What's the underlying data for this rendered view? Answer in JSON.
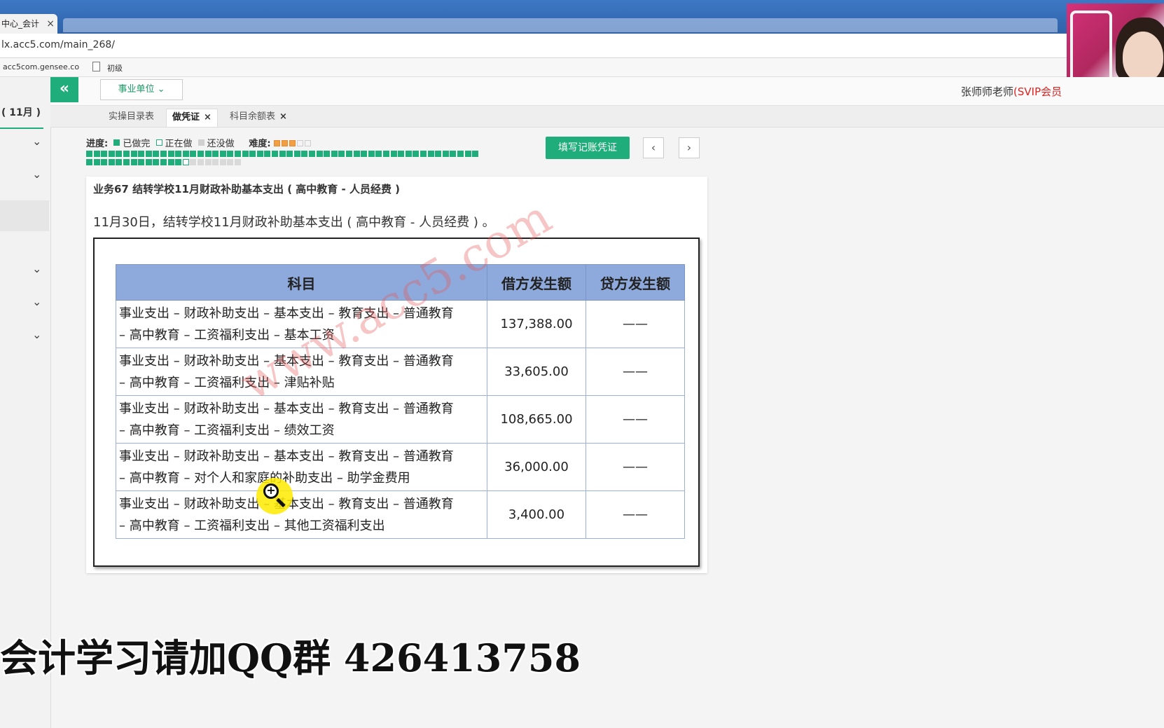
{
  "browser": {
    "tab_title": "中心_会计",
    "tab_close": "×",
    "url": "lx.acc5.com/main_268/",
    "bookmarks": [
      "acc5com.gensee.co",
      "初级"
    ]
  },
  "sidebar": {
    "title": "( 11月 )",
    "chevron": "⌄"
  },
  "header": {
    "collapse_label": "«",
    "unit_select": "事业单位 ⌄",
    "teacher_name": "张师师老师",
    "teacher_badge": "(SVIP会员"
  },
  "page_tabs": [
    {
      "label": "实操目录表",
      "closable": false
    },
    {
      "label": "做凭证",
      "closable": true
    },
    {
      "label": "科目余额表",
      "closable": true
    }
  ],
  "progress": {
    "label": "进度:",
    "legend_done": "已做完",
    "legend_doing": "正在做",
    "legend_todo": "还没做",
    "difficulty_label": "难度:",
    "difficulty_stars": 3,
    "difficulty_max": 5,
    "done_count": 66,
    "current_index": 23,
    "todo_count": 10,
    "colors": {
      "done": "#1fae7b",
      "doing": "#ffffff",
      "todo": "#d9d9d9"
    }
  },
  "actions": {
    "fill_voucher": "填写记账凭证",
    "prev": "‹",
    "next": "›"
  },
  "business": {
    "title": "业务67 结转学校11月财政补助基本支出 ( 高中教育 - 人员经费 )",
    "description": "11月30日，结转学校11月财政补助基本支出 ( 高中教育 - 人员经费 ) 。"
  },
  "table": {
    "headers": [
      "科目",
      "借方发生额",
      "贷方发生额"
    ],
    "rows": [
      {
        "line1": "事业支出 – 财政补助支出 – 基本支出 – 教育支出 – 普通教育",
        "line2": "– 高中教育 – 工资福利支出 – 基本工资",
        "debit": "137,388.00",
        "credit": "——"
      },
      {
        "line1": "事业支出 – 财政补助支出 – 基本支出 – 教育支出 – 普通教育",
        "line2": "– 高中教育 – 工资福利支出 – 津贴补贴",
        "debit": "33,605.00",
        "credit": "——"
      },
      {
        "line1": "事业支出 – 财政补助支出 – 基本支出 – 教育支出 – 普通教育",
        "line2": "– 高中教育 – 工资福利支出 – 绩效工资",
        "debit": "108,665.00",
        "credit": "——"
      },
      {
        "line1": "事业支出 – 财政补助支出 – 基本支出 – 教育支出 – 普通教育",
        "line2": "– 高中教育 – 对个人和家庭的补助支出 – 助学金费用",
        "debit": "36,000.00",
        "credit": "——"
      },
      {
        "line1": "事业支出 – 财政补助支出 – 基本支出 – 教育支出 – 普通教育",
        "line2": "– 高中教育 – 工资福利支出 – 其他工资福利支出",
        "debit": "3,400.00",
        "credit": "——"
      }
    ]
  },
  "watermark": "www.acc5.com",
  "caption": "会计学习请加QQ群 426413758"
}
